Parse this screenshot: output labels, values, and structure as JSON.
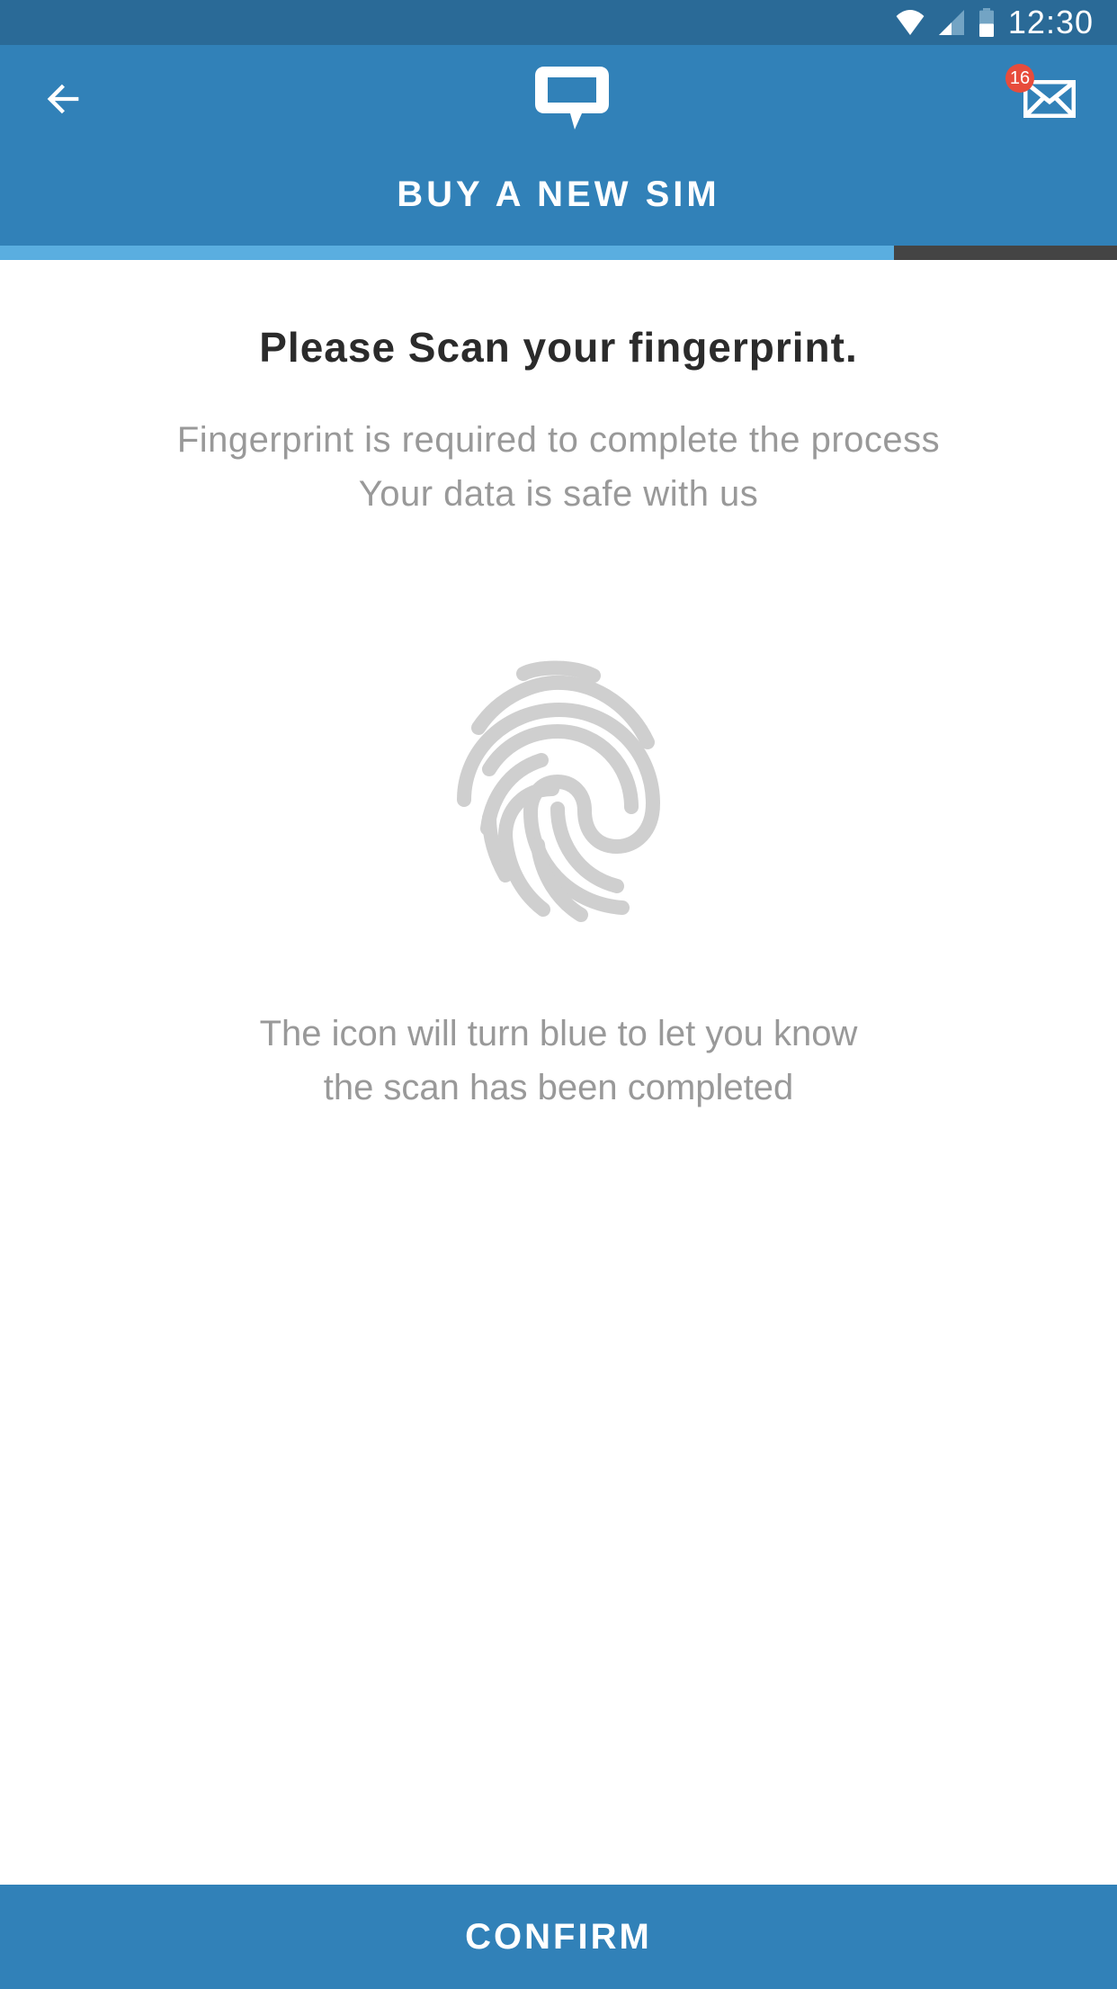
{
  "status_bar": {
    "time": "12:30"
  },
  "header": {
    "notifications_count": "16",
    "title": "BUY A NEW SIM"
  },
  "progress": {
    "percent": 80
  },
  "content": {
    "title": "Please Scan your fingerprint.",
    "subtitle": "Fingerprint is required to complete the process\nYour data is safe with us",
    "hint": "The icon will turn blue to let you know\nthe scan has been completed"
  },
  "actions": {
    "confirm_label": "CONFIRM"
  }
}
